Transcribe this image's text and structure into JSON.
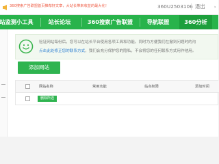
{
  "topbar": {
    "notice": "360搜索广告联盟首页推荐好文章，大站长带来收益的最大化！",
    "site_id": "360U2503106",
    "logout": "退出",
    "arrow": "›"
  },
  "nav": {
    "items": [
      {
        "label": "站监测小工具"
      },
      {
        "label": "站长论坛"
      },
      {
        "label": "360搜索广告联盟"
      },
      {
        "label": "导航联盟"
      },
      {
        "label": "360分析"
      }
    ],
    "active_index": 4,
    "colors": {
      "bar": "#28b34b",
      "active": "#1d9f3c"
    }
  },
  "info": {
    "line1": "验证网站每份后，您可以在站长平台使用各项工具和功能。同时为方便我们在撤到问题时的沟",
    "link_text": "点击此处修正您的联系方式",
    "line2_rest": "，我们会充分保护您的隐私，不会将您的任何联系方式用作他用。"
  },
  "add_button": {
    "label": "添加网站"
  },
  "table": {
    "headers": [
      "网站名称",
      "常用功能",
      "站点权限",
      "添加时间"
    ],
    "delete_button": "删除所选"
  },
  "accent": "#2fb450"
}
